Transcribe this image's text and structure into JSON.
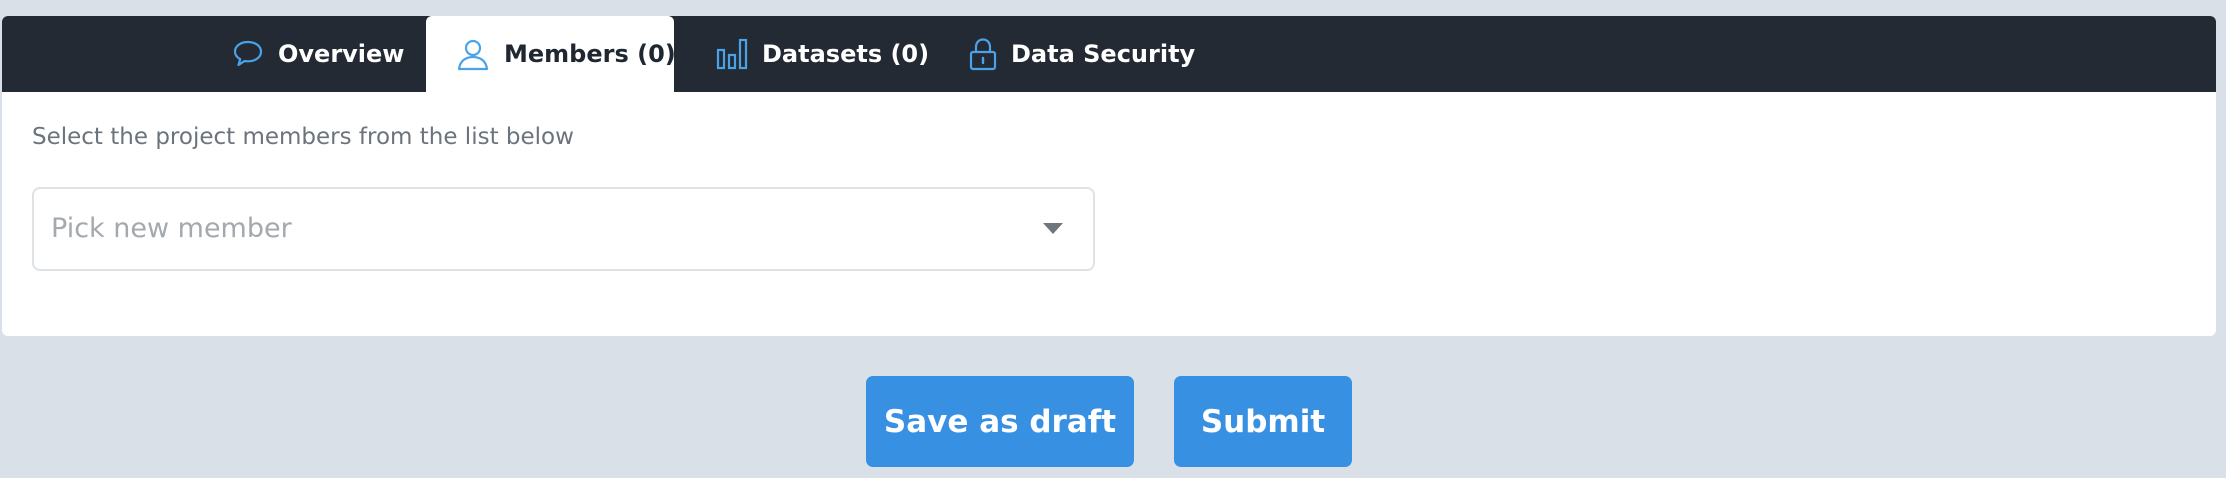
{
  "tabs": [
    {
      "id": "overview",
      "label": "Overview",
      "icon": "chat-bubble-icon",
      "active": false
    },
    {
      "id": "members",
      "label": "Members (0)",
      "icon": "user-icon",
      "active": true
    },
    {
      "id": "datasets",
      "label": "Datasets (0)",
      "icon": "bar-chart-icon",
      "active": false
    },
    {
      "id": "security",
      "label": "Data Security",
      "icon": "lock-icon",
      "active": false
    }
  ],
  "members_panel": {
    "instructions": "Select the project members from the list below",
    "picker": {
      "placeholder": "Pick new member",
      "value": ""
    }
  },
  "actions": {
    "save_draft_label": "Save as draft",
    "submit_label": "Submit"
  },
  "colors": {
    "page_background": "#d9e0e7",
    "tab_bar": "#232a33",
    "accent": "#3890e3",
    "icon_accent": "#4aa3e8"
  }
}
